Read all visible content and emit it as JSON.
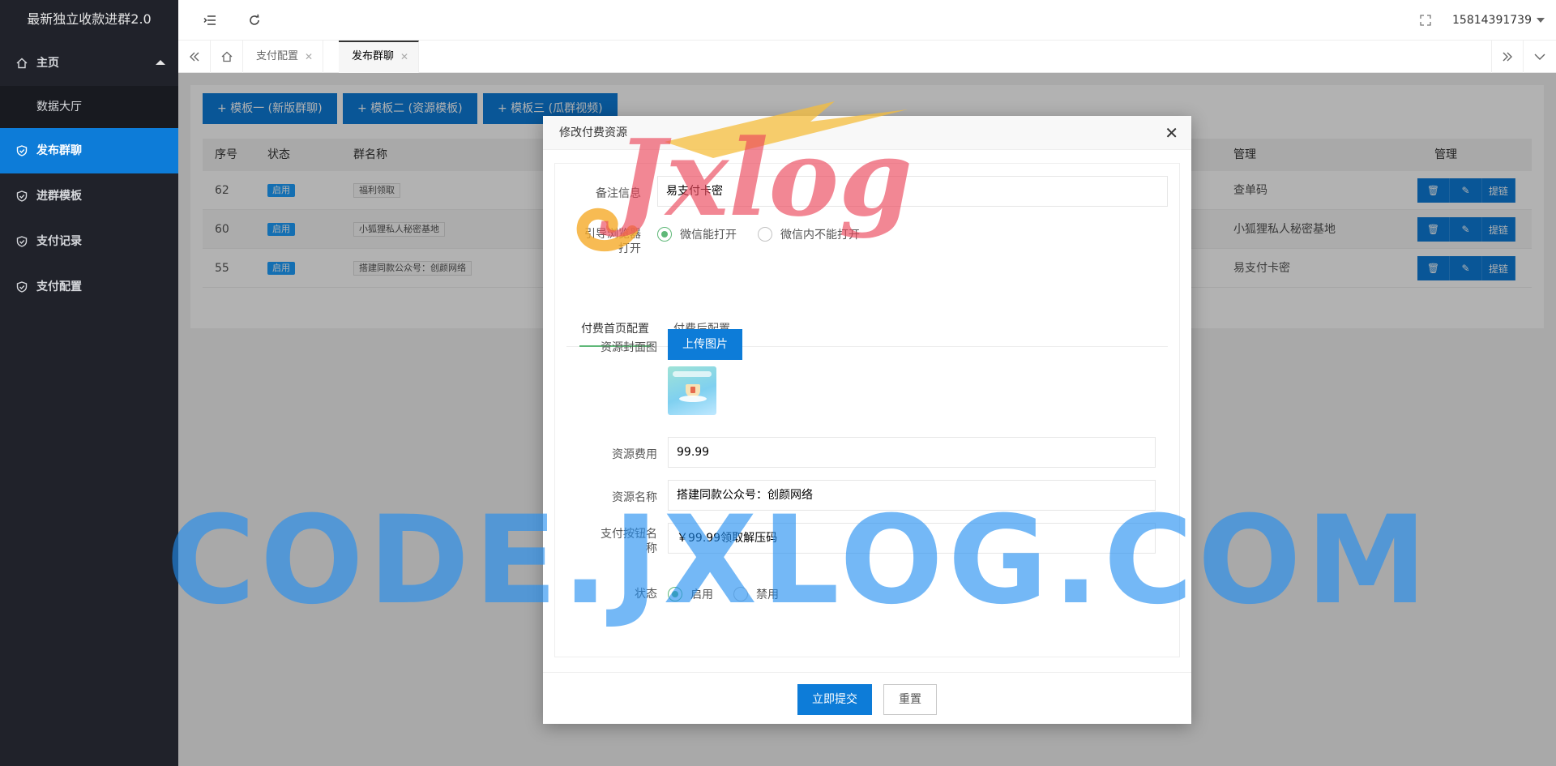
{
  "app": {
    "title": "最新独立收款进群2.0"
  },
  "sidebar": {
    "items": [
      {
        "label": "主页"
      },
      {
        "label": "数据大厅"
      },
      {
        "label": "发布群聊"
      },
      {
        "label": "进群模板"
      },
      {
        "label": "支付记录"
      },
      {
        "label": "支付配置"
      }
    ]
  },
  "header": {
    "user": "15814391739"
  },
  "tabs": [
    {
      "label": "支付配置"
    },
    {
      "label": "发布群聊"
    }
  ],
  "main": {
    "template_buttons": [
      "+ 模板一 (新版群聊)",
      "+ 模板二 (资源模板)",
      "+ 模板三 (瓜群视频)"
    ],
    "columns": [
      "序号",
      "状态",
      "群名称",
      "管理",
      "管理"
    ],
    "rows": [
      {
        "id": "62",
        "status": "启用",
        "name": "福利领取",
        "manage": "查单码"
      },
      {
        "id": "60",
        "status": "启用",
        "name": "小狐狸私人秘密基地",
        "manage": "小狐狸私人秘密基地"
      },
      {
        "id": "55",
        "status": "启用",
        "name": "搭建同款公众号：创颜网络",
        "manage": "易支付卡密"
      }
    ],
    "actions": {
      "delete_icon": "trash-icon",
      "edit_icon": "pencil-icon",
      "link_label": "提链"
    }
  },
  "modal": {
    "title": "修改付费资源",
    "remark_label": "备注信息",
    "remark_value": "易支付卡密",
    "browser_label_1": "引导浏览器",
    "browser_label_2": "打开",
    "browser_options": [
      "微信能打开",
      "微信内不能打开"
    ],
    "subtabs": [
      "付费首页配置",
      "付费后配置"
    ],
    "cover_label": "资源封面图",
    "upload_label": "上传图片",
    "fee_label": "资源费用",
    "fee_value": "99.99",
    "name_label": "资源名称",
    "name_value": "搭建同款公众号：创颜网络",
    "paybtn_label_1": "支付按钮名",
    "paybtn_label_2": "称",
    "paybtn_value": "￥99.99领取解压码",
    "status_label": "状态",
    "status_options": [
      "启用",
      "禁用"
    ],
    "submit_label": "立即提交",
    "reset_label": "重置"
  },
  "watermark": {
    "text": "CODE.JXLOG.COM",
    "logo_text": "Jxlog"
  },
  "colors": {
    "primary": "#0d7cd8",
    "sidebar": "#20222a",
    "accent_green": "#5fb878",
    "badge": "#1e9fff"
  }
}
